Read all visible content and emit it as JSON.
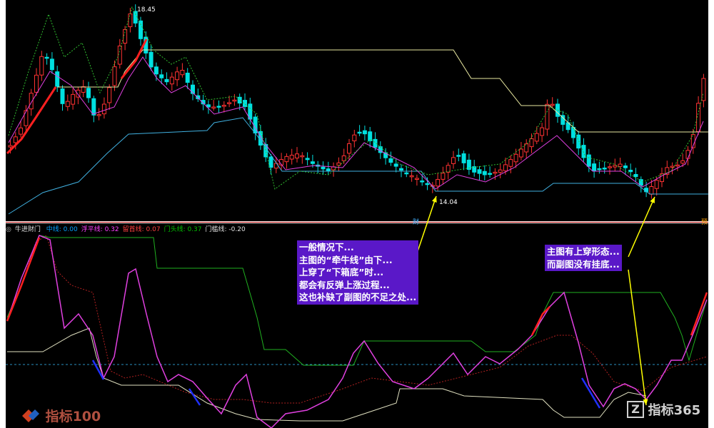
{
  "main": {
    "high_label": "18.45",
    "low_label": "14.04",
    "cai_tag": "财",
    "right_tag": "预"
  },
  "indicator": {
    "name": "牛进财门",
    "params": [
      {
        "label": "中线: 0.00",
        "color": "#00a0ff"
      },
      {
        "label": "浮平线: 0.32",
        "color": "#ff40ff"
      },
      {
        "label": "留首线: 0.07",
        "color": "#ff4040"
      },
      {
        "label": "门头线: 0.37",
        "color": "#00c000"
      },
      {
        "label": "门槛线: -0.20",
        "color": "#e0e0e0"
      }
    ]
  },
  "notes": {
    "left": "一般情况下...\n主图的“牵牛线”由下...\n上穿了“下箱底”时...\n都会有反弹上涨过程...\n这也补缺了副图的不足之处...",
    "right": "主图有上穿形态...\n而副图没有挂底..."
  },
  "logos": {
    "left": "指标100",
    "right": "指标365"
  },
  "colors": {
    "up": "#ff3232",
    "down": "#00e0e0",
    "bg": "#000000",
    "niu": "#ff2020",
    "xiangdi": "#40b0e0",
    "shangxiang": "#e8e8a0",
    "annotation": "#5a18c8",
    "arrow": "#ffff00"
  },
  "chart_data": [
    {
      "type": "candlestick",
      "title": "",
      "xlabel": "",
      "ylabel": "",
      "annotations": [
        "18.45",
        "14.04"
      ],
      "series": []
    },
    {
      "type": "line",
      "title": "牛进财门",
      "xlabel": "",
      "ylabel": "",
      "series": [
        {
          "name": "中线",
          "value": 0.0
        },
        {
          "name": "浮平线",
          "value": 0.32
        },
        {
          "name": "留首线",
          "value": 0.07
        },
        {
          "name": "门头线",
          "value": 0.37
        },
        {
          "name": "门槛线",
          "value": -0.2
        }
      ]
    }
  ]
}
